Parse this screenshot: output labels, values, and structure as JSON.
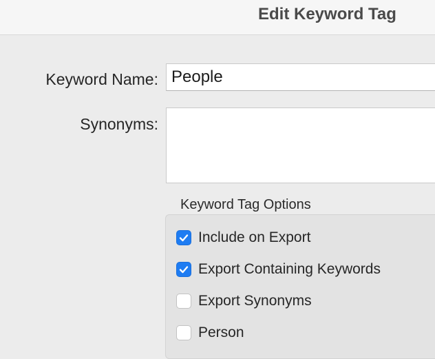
{
  "window": {
    "title": "Edit Keyword Tag"
  },
  "form": {
    "name_label": "Keyword Name:",
    "name_value": "People",
    "synonyms_label": "Synonyms:",
    "synonyms_value": ""
  },
  "options": {
    "group_title": "Keyword Tag Options",
    "items": [
      {
        "label": "Include on Export",
        "checked": true
      },
      {
        "label": "Export Containing Keywords",
        "checked": true
      },
      {
        "label": "Export Synonyms",
        "checked": false
      },
      {
        "label": "Person",
        "checked": false
      }
    ]
  },
  "colors": {
    "accent": "#1e7cf2",
    "window_bg": "#ececec",
    "title_text": "#4a4a4a"
  },
  "icons": {
    "checkmark": "checkmark-icon"
  }
}
